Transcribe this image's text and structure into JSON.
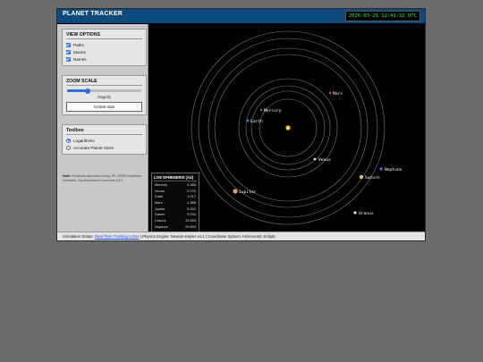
{
  "app": {
    "title": "PLANET TRACKER",
    "clock": "2026-03-25 12:41:12 UTC"
  },
  "view_options": {
    "title": "VIEW OPTIONS",
    "items": [
      {
        "label": "Paths",
        "checked": true
      },
      {
        "label": "Moons",
        "checked": true
      },
      {
        "label": "Names",
        "checked": true
      }
    ]
  },
  "zoom": {
    "title": "ZOOM SCALE",
    "level": 0.28,
    "slider_label": "Magnify",
    "center_button": "Center Sun"
  },
  "toolbox": {
    "title": "Toolbox",
    "options": [
      {
        "label": "Logarithmic",
        "selected": true
      },
      {
        "label": "Accurate Planet Sizes",
        "selected": false
      }
    ]
  },
  "note": {
    "label": "Note:",
    "text": "Positions calculated using JPL J2000 Keplerian elements. Synchronized to real-time UTC."
  },
  "ephemeris": {
    "title": "LIVE EPHEMERIS (AU)",
    "rows": [
      {
        "name": "Mercury",
        "value": "0.466"
      },
      {
        "name": "Venus",
        "value": "0.720"
      },
      {
        "name": "Earth",
        "value": "1.017"
      },
      {
        "name": "Mars",
        "value": "1.386"
      },
      {
        "name": "Jupiter",
        "value": "5.301"
      },
      {
        "name": "Saturn",
        "value": "9.031"
      },
      {
        "name": "Uranus",
        "value": "19.653"
      },
      {
        "name": "Neptune",
        "value": "29.802"
      }
    ]
  },
  "planets": [
    {
      "name": "Mercury",
      "color": "#c9c9c9"
    },
    {
      "name": "Venus",
      "color": "#e8d9a8"
    },
    {
      "name": "Earth",
      "color": "#3f7fe0"
    },
    {
      "name": "Mars",
      "color": "#d2553a"
    },
    {
      "name": "Jupiter",
      "color": "#d8a070"
    },
    {
      "name": "Saturn",
      "color": "#d9c070"
    },
    {
      "name": "Uranus",
      "color": "#bfe6ee"
    },
    {
      "name": "Neptune",
      "color": "#5a78e0"
    }
  ],
  "sun": {
    "color": "#ffd21c"
  },
  "status": {
    "prefix": "Simulation Status:",
    "active": "Real-Time Tracking Active",
    "rest": "| Physics Engine: Newton-Kepler v4.2 | Coordinate System: Heliocentric Ecliptic"
  }
}
